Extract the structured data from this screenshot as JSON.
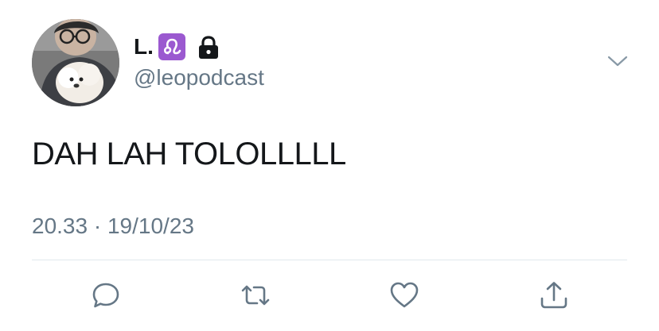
{
  "author": {
    "display_name": "L.",
    "zodiac_badge": "leo-sign",
    "handle": "@leopodcast",
    "protected_account": true
  },
  "tweet": {
    "text": "DAH LAH TOLOLLLLL",
    "time": "20.33",
    "separator": "·",
    "date": "19/10/23"
  },
  "actions": [
    "reply-icon",
    "retweet-icon",
    "like-icon",
    "share-icon"
  ],
  "colors": {
    "text": "#14171a",
    "secondary": "#657786",
    "divider": "#e1e8ed",
    "badge": "#9b59d0"
  }
}
